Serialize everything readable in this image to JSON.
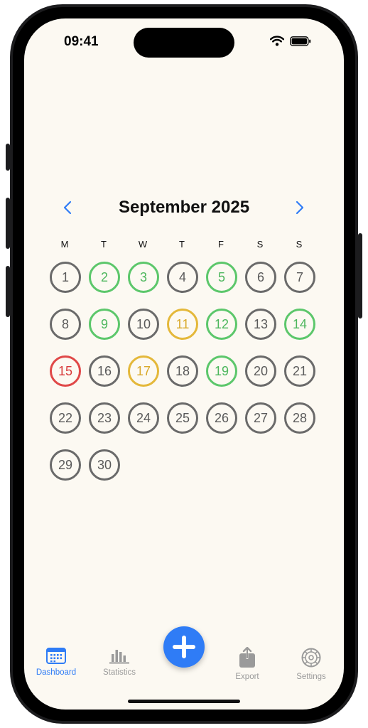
{
  "status": {
    "time": "09:41"
  },
  "calendar": {
    "title": "September 2025",
    "prev_icon": "chevron-left-icon",
    "next_icon": "chevron-right-icon",
    "weekdays": [
      "M",
      "T",
      "W",
      "T",
      "F",
      "S",
      "S"
    ],
    "days": [
      {
        "n": "1",
        "s": "none"
      },
      {
        "n": "2",
        "s": "green"
      },
      {
        "n": "3",
        "s": "green"
      },
      {
        "n": "4",
        "s": "none"
      },
      {
        "n": "5",
        "s": "green"
      },
      {
        "n": "6",
        "s": "none"
      },
      {
        "n": "7",
        "s": "none"
      },
      {
        "n": "8",
        "s": "none"
      },
      {
        "n": "9",
        "s": "green"
      },
      {
        "n": "10",
        "s": "none"
      },
      {
        "n": "11",
        "s": "yellow"
      },
      {
        "n": "12",
        "s": "green"
      },
      {
        "n": "13",
        "s": "none"
      },
      {
        "n": "14",
        "s": "green"
      },
      {
        "n": "15",
        "s": "red"
      },
      {
        "n": "16",
        "s": "none"
      },
      {
        "n": "17",
        "s": "yellow"
      },
      {
        "n": "18",
        "s": "none"
      },
      {
        "n": "19",
        "s": "green"
      },
      {
        "n": "20",
        "s": "none"
      },
      {
        "n": "21",
        "s": "none"
      },
      {
        "n": "22",
        "s": "none"
      },
      {
        "n": "23",
        "s": "none"
      },
      {
        "n": "24",
        "s": "none"
      },
      {
        "n": "25",
        "s": "none"
      },
      {
        "n": "26",
        "s": "none"
      },
      {
        "n": "27",
        "s": "none"
      },
      {
        "n": "28",
        "s": "none"
      },
      {
        "n": "29",
        "s": "none"
      },
      {
        "n": "30",
        "s": "none"
      }
    ],
    "colors": {
      "green": "#5cc76b",
      "yellow": "#e4b83a",
      "red": "#e04848",
      "none": "#6a6a6a"
    }
  },
  "tabbar": {
    "tabs": [
      {
        "label": "Dashboard",
        "icon": "calendar-icon",
        "active": true
      },
      {
        "label": "Statistics",
        "icon": "bar-chart-icon",
        "active": false
      },
      {
        "label": "Export",
        "icon": "share-icon",
        "active": false
      },
      {
        "label": "Settings",
        "icon": "gear-icon",
        "active": false
      }
    ],
    "add_icon": "plus-icon"
  },
  "accent": "#2f7cf6",
  "background": "#fcf9f2"
}
